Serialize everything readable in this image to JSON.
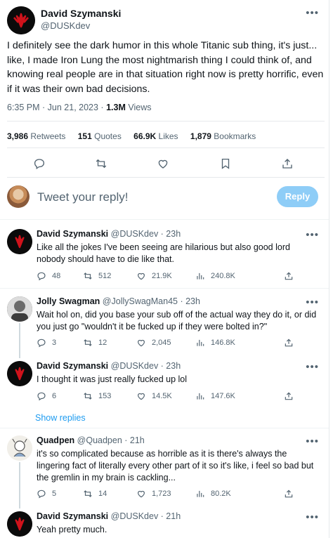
{
  "main_tweet": {
    "author_name": "David Szymanski",
    "author_handle": "@DUSKdev",
    "text": "I definitely see the dark humor in this whole Titanic sub thing, it's just... like, I made Iron Lung the most nightmarish thing I could think of, and knowing real people are in that situation right now is pretty horrific, even if it was their own bad decisions.",
    "time": "6:35 PM · Jun 21, 2023 ·",
    "views_value": "1.3M",
    "views_label": "Views",
    "retweets_value": "3,986",
    "retweets_label": "Retweets",
    "quotes_value": "151",
    "quotes_label": "Quotes",
    "likes_value": "66.9K",
    "likes_label": "Likes",
    "bookmarks_value": "1,879",
    "bookmarks_label": "Bookmarks"
  },
  "composer": {
    "placeholder": "Tweet your reply!",
    "button_label": "Reply"
  },
  "replies": [
    {
      "name": "David Szymanski",
      "handle_time": "@DUSKdev · 23h",
      "text": "Like all the jokes I've been seeing are hilarious but also good lord nobody should have to die like that.",
      "replies": "48",
      "retweets": "512",
      "likes": "21.9K",
      "views": "240.8K"
    },
    {
      "name": "Jolly Swagman",
      "handle_time": "@JollySwagMan45 · 23h",
      "text": "Wait hol on, did you base your sub off of the actual way they do it, or did you just go \"wouldn't it be fucked up if they were bolted in?\"",
      "replies": "3",
      "retweets": "12",
      "likes": "2,045",
      "views": "146.8K"
    },
    {
      "name": "David Szymanski",
      "handle_time": "@DUSKdev · 23h",
      "text": "I thought it was just really fucked up lol",
      "replies": "6",
      "retweets": "153",
      "likes": "14.5K",
      "views": "147.6K"
    },
    {
      "name": "Quadpen",
      "handle_time": "@Quadpen · 21h",
      "text": "it's so complicated because as horrible as it is there's always the lingering fact of literally every other part of it so it's like, i feel so bad but the gremlin in my brain is cackling...",
      "replies": "5",
      "retweets": "14",
      "likes": "1,723",
      "views": "80.2K"
    },
    {
      "name": "David Szymanski",
      "handle_time": "@DUSKdev · 21h",
      "text": "Yeah pretty much."
    }
  ],
  "show_replies_label": "Show replies",
  "colors": {
    "accent": "#1d9bf0",
    "reply_button_disabled": "#8ecdf7",
    "muted": "#536471"
  },
  "icons": [
    "more-icon",
    "reply-icon",
    "retweet-icon",
    "like-icon",
    "bookmark-icon",
    "share-icon",
    "views-icon"
  ]
}
